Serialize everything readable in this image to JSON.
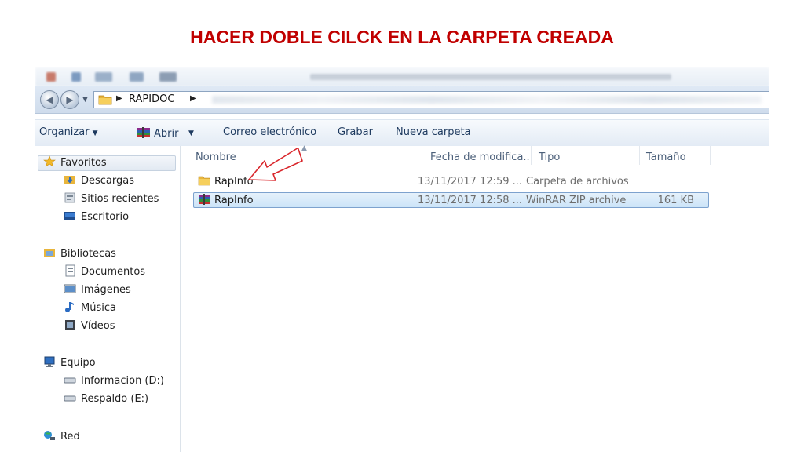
{
  "slide": {
    "title": "HACER DOBLE CILCK EN LA CARPETA CREADA"
  },
  "address": {
    "crumb": "RAPIDOC"
  },
  "toolbar": {
    "organize": "Organizar",
    "open": "Abrir",
    "email": "Correo electrónico",
    "burn": "Grabar",
    "new_folder": "Nueva carpeta"
  },
  "nav": {
    "favorites": "Favoritos",
    "downloads": "Descargas",
    "recent": "Sitios recientes",
    "desktop": "Escritorio",
    "libraries": "Bibliotecas",
    "documents": "Documentos",
    "images": "Imágenes",
    "music": "Música",
    "videos": "Vídeos",
    "computer": "Equipo",
    "drive_d": "Informacion (D:)",
    "drive_e": "Respaldo (E:)",
    "network": "Red"
  },
  "columns": {
    "name": "Nombre",
    "date": "Fecha de modifica...",
    "type": "Tipo",
    "size": "Tamaño"
  },
  "files": [
    {
      "name": "RapInfo",
      "date": "13/11/2017 12:59 ...",
      "type": "Carpeta de archivos",
      "size": "",
      "icon": "folder-icon"
    },
    {
      "name": "RapInfo",
      "date": "13/11/2017 12:58 ...",
      "type": "WinRAR ZIP archive",
      "size": "161 KB",
      "icon": "winrar-icon"
    }
  ],
  "colors": {
    "title_red": "#c00000",
    "arrow_red": "#d9262b",
    "selection": "#cce4f8"
  }
}
